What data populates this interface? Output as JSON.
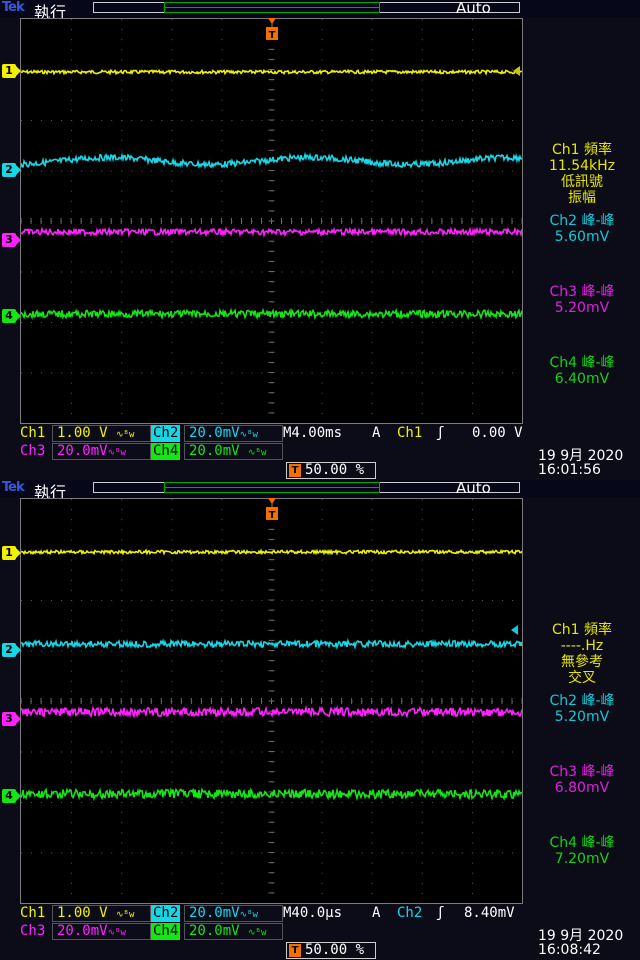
{
  "colors": {
    "ch1": "#f2f200",
    "ch2": "#14d8e8",
    "ch3": "#ff22ff",
    "ch4": "#14e614",
    "trigger": "#f07000",
    "frame": "#7a7a7a"
  },
  "screens": [
    {
      "brand": "Tek",
      "run_state": "執行",
      "trigger_mode": "Auto",
      "channels": [
        {
          "label": "1"
        },
        {
          "label": "2"
        },
        {
          "label": "3"
        },
        {
          "label": "4"
        }
      ],
      "measurements": [
        {
          "title": "Ch1 頻率",
          "lines": [
            "11.54kHz",
            "低訊號",
            "振幅"
          ],
          "color": "ch1"
        },
        {
          "title": "Ch2 峰-峰",
          "lines": [
            "5.60mV"
          ],
          "color": "ch2"
        },
        {
          "title": "Ch3 峰-峰",
          "lines": [
            "5.20mV"
          ],
          "color": "ch3"
        },
        {
          "title": "Ch4 峰-峰",
          "lines": [
            "6.40mV"
          ],
          "color": "ch4"
        }
      ],
      "status": {
        "ch1_label": "Ch1",
        "ch1_scale": "1.00 V",
        "ch2_label": "Ch2",
        "ch2_scale": "20.0mV",
        "ch3_label": "Ch3",
        "ch3_scale": "20.0mV",
        "ch4_label": "Ch4",
        "ch4_scale": "20.0mV",
        "timebase": "M4.00ms",
        "acq": "A",
        "trig_source": "Ch1",
        "trig_level": "0.00 V",
        "trig_position": "50.00 %",
        "date": "19 9月  2020",
        "time": "16:01:56"
      }
    },
    {
      "brand": "Tek",
      "run_state": "執行",
      "trigger_mode": "Auto",
      "channels": [
        {
          "label": "1"
        },
        {
          "label": "2"
        },
        {
          "label": "3"
        },
        {
          "label": "4"
        }
      ],
      "measurements": [
        {
          "title": "Ch1 頻率",
          "lines": [
            "----.Hz",
            "無參考",
            "交叉"
          ],
          "color": "ch1"
        },
        {
          "title": "Ch2 峰-峰",
          "lines": [
            "5.20mV"
          ],
          "color": "ch2"
        },
        {
          "title": "Ch3 峰-峰",
          "lines": [
            "6.80mV"
          ],
          "color": "ch3"
        },
        {
          "title": "Ch4 峰-峰",
          "lines": [
            "7.20mV"
          ],
          "color": "ch4"
        }
      ],
      "status": {
        "ch1_label": "Ch1",
        "ch1_scale": "1.00 V",
        "ch2_label": "Ch2",
        "ch2_scale": "20.0mV",
        "ch3_label": "Ch3",
        "ch3_scale": "20.0mV",
        "ch4_label": "Ch4",
        "ch4_scale": "20.0mV",
        "timebase": "M40.0µs",
        "acq": "A",
        "trig_source": "Ch2",
        "trig_level": "8.40mV",
        "trig_position": "50.00 %",
        "date": "19 9月  2020",
        "time": "16:08:42"
      }
    }
  ]
}
